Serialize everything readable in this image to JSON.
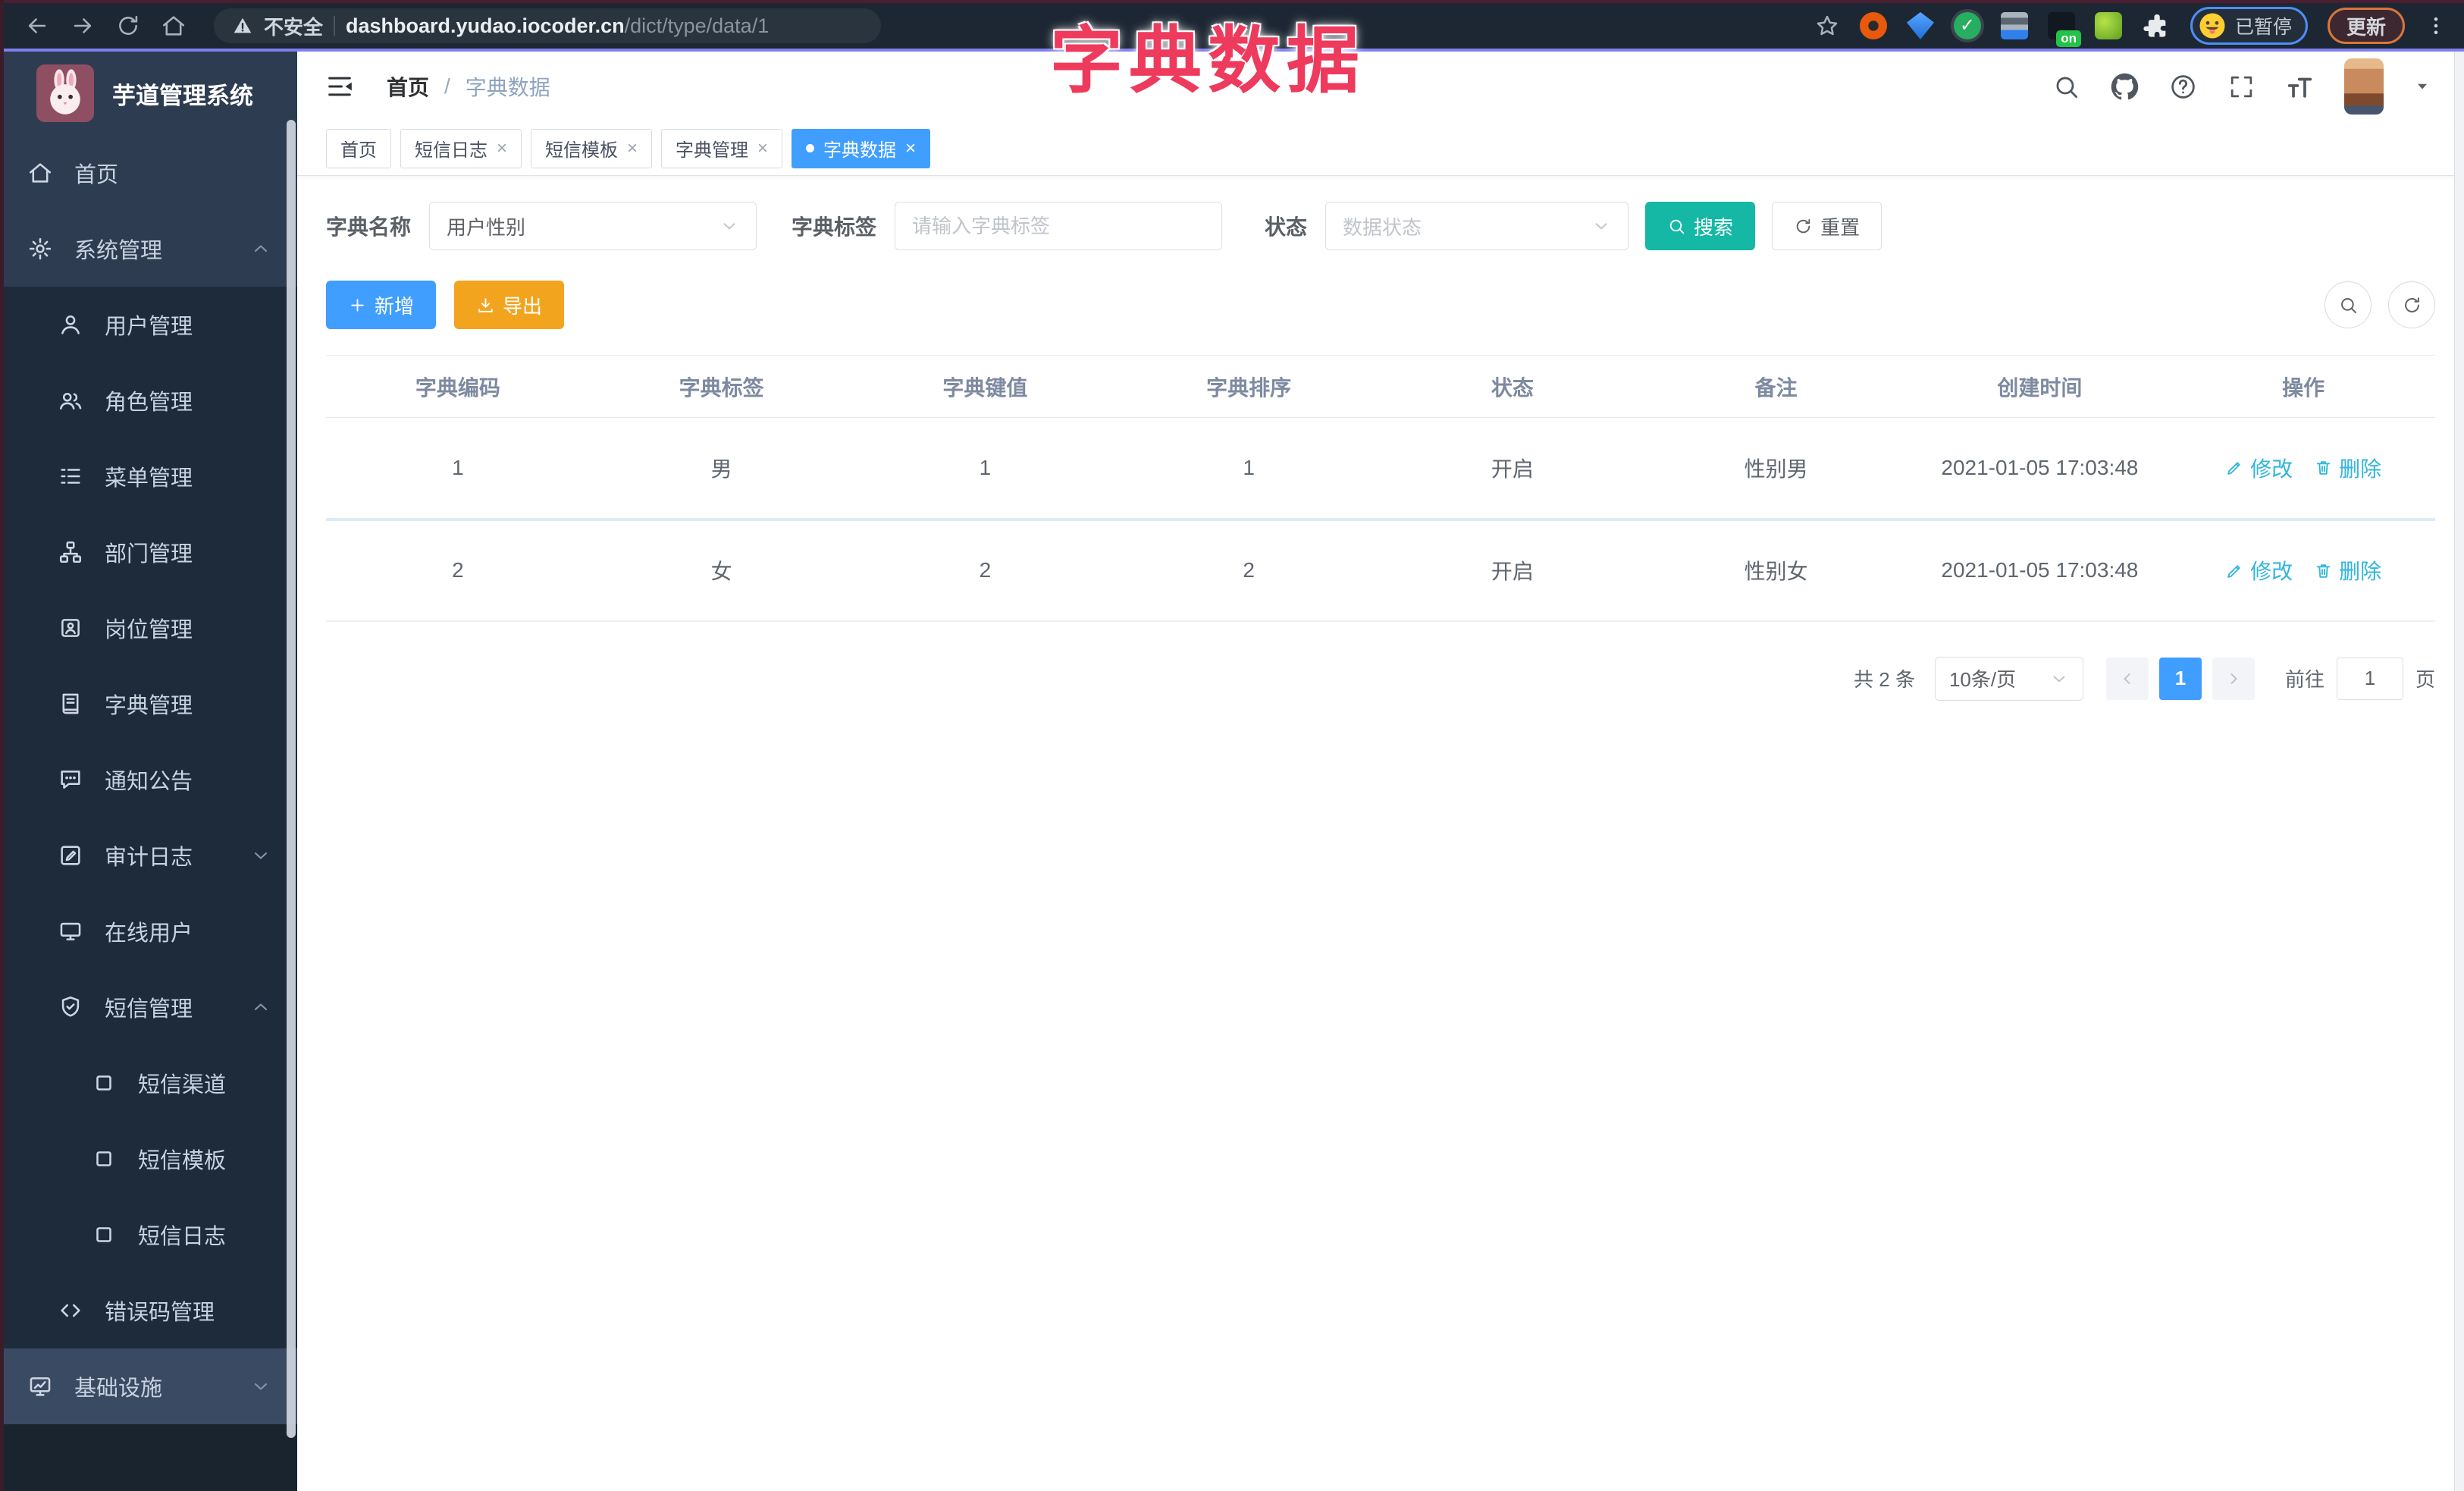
{
  "browser": {
    "security_label": "不安全",
    "url_domain": "dashboard.yudao.iocoder.cn",
    "url_path": "/dict/type/data/1",
    "on_badge": "on",
    "paused_label": "已暂停",
    "update_label": "更新"
  },
  "overlay_title": "字典数据",
  "sidebar": {
    "app_title": "芋道管理系统",
    "items": [
      {
        "label": "首页",
        "icon": "home-icon",
        "level": 1
      },
      {
        "label": "系统管理",
        "icon": "gear-icon",
        "level": 1,
        "chevron": "up"
      },
      {
        "label": "用户管理",
        "icon": "user-icon",
        "level": 2
      },
      {
        "label": "角色管理",
        "icon": "users-icon",
        "level": 2
      },
      {
        "label": "菜单管理",
        "icon": "menu-list-icon",
        "level": 2
      },
      {
        "label": "部门管理",
        "icon": "org-tree-icon",
        "level": 2
      },
      {
        "label": "岗位管理",
        "icon": "badge-icon",
        "level": 2
      },
      {
        "label": "字典管理",
        "icon": "dictionary-icon",
        "level": 2
      },
      {
        "label": "通知公告",
        "icon": "announcement-icon",
        "level": 2
      },
      {
        "label": "审计日志",
        "icon": "audit-log-icon",
        "level": 2,
        "chevron": "down"
      },
      {
        "label": "在线用户",
        "icon": "online-user-icon",
        "level": 2
      },
      {
        "label": "短信管理",
        "icon": "sms-shield-icon",
        "level": 2,
        "chevron": "up"
      },
      {
        "label": "短信渠道",
        "icon": "square-icon",
        "level": 3
      },
      {
        "label": "短信模板",
        "icon": "square-icon",
        "level": 3
      },
      {
        "label": "短信日志",
        "icon": "square-icon",
        "level": 3
      },
      {
        "label": "错误码管理",
        "icon": "code-icon",
        "level": 2
      },
      {
        "label": "基础设施",
        "icon": "infra-icon",
        "level": 1,
        "chevron": "down",
        "accent": true
      }
    ]
  },
  "header": {
    "breadcrumb_home": "首页",
    "breadcrumb_separator": "/",
    "breadcrumb_current": "字典数据"
  },
  "tabs": [
    {
      "label": "首页",
      "closable": false,
      "active": false
    },
    {
      "label": "短信日志",
      "closable": true,
      "active": false
    },
    {
      "label": "短信模板",
      "closable": true,
      "active": false
    },
    {
      "label": "字典管理",
      "closable": true,
      "active": false
    },
    {
      "label": "字典数据",
      "closable": true,
      "active": true
    }
  ],
  "filters": {
    "name_label": "字典名称",
    "name_value": "用户性别",
    "tag_label": "字典标签",
    "tag_placeholder": "请输入字典标签",
    "status_label": "状态",
    "status_placeholder": "数据状态",
    "search_label": "搜索",
    "reset_label": "重置"
  },
  "toolbar": {
    "add_label": "新增",
    "export_label": "导出"
  },
  "table": {
    "columns": [
      "字典编码",
      "字典标签",
      "字典键值",
      "字典排序",
      "状态",
      "备注",
      "创建时间",
      "操作"
    ],
    "rows": [
      {
        "code": "1",
        "label": "男",
        "value": "1",
        "sort": "1",
        "status": "开启",
        "remark": "性别男",
        "created": "2021-01-05 17:03:48"
      },
      {
        "code": "2",
        "label": "女",
        "value": "2",
        "sort": "2",
        "status": "开启",
        "remark": "性别女",
        "created": "2021-01-05 17:03:48"
      }
    ],
    "edit_label": "修改",
    "delete_label": "删除"
  },
  "pagination": {
    "total_label": "共 2 条",
    "page_size_value": "10条/页",
    "current_page": "1",
    "goto_label": "前往",
    "goto_value": "1",
    "goto_suffix": "页"
  },
  "colors": {
    "primary": "#409eff",
    "search_teal": "#15b8a5",
    "export_orange": "#f3a41f",
    "overlay_title_red": "#ee3a5c",
    "sidebar_bg": "#2e3c51",
    "submenu_bg": "#1d2b3a"
  }
}
